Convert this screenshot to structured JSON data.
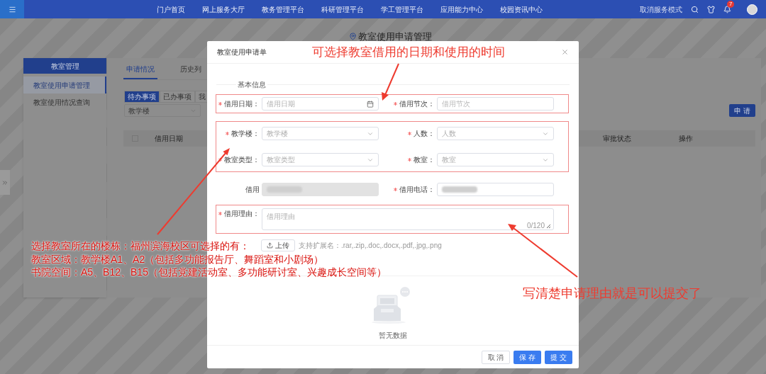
{
  "nav": {
    "menu_items": [
      "门户首页",
      "网上服务大厅",
      "教务管理平台",
      "科研管理平台",
      "学工管理平台",
      "应用能力中心",
      "校园资讯中心"
    ],
    "mode_text": "取消服务模式",
    "notification_count": "7"
  },
  "page": {
    "title": "教室使用申请管理",
    "sidebar": {
      "title": "教室管理",
      "items": [
        {
          "label": "教室使用申请管理",
          "selected": true
        },
        {
          "label": "教室使用情况查询",
          "selected": false
        }
      ]
    },
    "tabs": [
      {
        "label": "申请情况",
        "selected": true
      },
      {
        "label": "历史列",
        "selected": false
      }
    ],
    "subtabs": [
      {
        "label": "待办事项",
        "selected": true
      },
      {
        "label": "已办事项",
        "selected": false
      },
      {
        "label": "我",
        "selected": false
      }
    ],
    "filter": {
      "placeholder": "教学楼"
    },
    "apply_button": "申 请",
    "table": {
      "checked": false,
      "columns": [
        "借用日期",
        "审批状态",
        "操作"
      ]
    }
  },
  "modal": {
    "title": "教室使用申请单",
    "section": "基本信息",
    "rows": [
      {
        "highlighted": true,
        "fields": [
          {
            "label": "借用日期：",
            "required": true,
            "kind": "date",
            "placeholder": "借用日期"
          },
          {
            "label": "借用节次：",
            "required": true,
            "kind": "input",
            "placeholder": "借用节次"
          }
        ]
      },
      {
        "highlighted": true,
        "fields": [
          {
            "label": "教学楼：",
            "required": true,
            "kind": "select",
            "placeholder": "教学楼"
          },
          {
            "label": "人数：",
            "required": true,
            "kind": "select",
            "placeholder": "人数"
          },
          {
            "label": "教室类型：",
            "required": true,
            "kind": "select",
            "placeholder": "教室类型"
          },
          {
            "label": "教室：",
            "required": true,
            "kind": "select",
            "placeholder": "教室"
          }
        ]
      },
      {
        "highlighted": false,
        "fields": [
          {
            "label": "借用",
            "required": false,
            "kind": "redacted",
            "disabled": true
          },
          {
            "label": "借用电话：",
            "required": true,
            "kind": "redacted",
            "disabled": false
          }
        ]
      },
      {
        "highlighted": true,
        "fields": [
          {
            "label": "借用理由：",
            "required": true,
            "kind": "textarea",
            "placeholder": "借用理由",
            "counter": "0/120"
          }
        ]
      }
    ],
    "upload": {
      "button": "上传",
      "hint": "支持扩展名：.rar,.zip,.doc,.docx,.pdf,.jpg,.png"
    },
    "empty_text": "暂无数据",
    "buttons": [
      {
        "label": "取 消",
        "kind": "default"
      },
      {
        "label": "保 存",
        "kind": "primary"
      },
      {
        "label": "提 交",
        "kind": "primary"
      }
    ]
  },
  "annotations": [
    {
      "lines": [
        "可选择教室借用的日期和使用的时间"
      ]
    },
    {
      "lines": [
        "选择教室所在的楼栋：福州滨海校区可选择的有：",
        "教室区域：教学楼A1、A2（包括多功能报告厅、舞蹈室和小剧场）",
        "书院空间：A5、B12、B15（包括党建活动室、多功能研讨室、兴趣成长空间等）"
      ]
    },
    {
      "lines": [
        "写清楚申请理由就是可以提交了"
      ]
    }
  ]
}
